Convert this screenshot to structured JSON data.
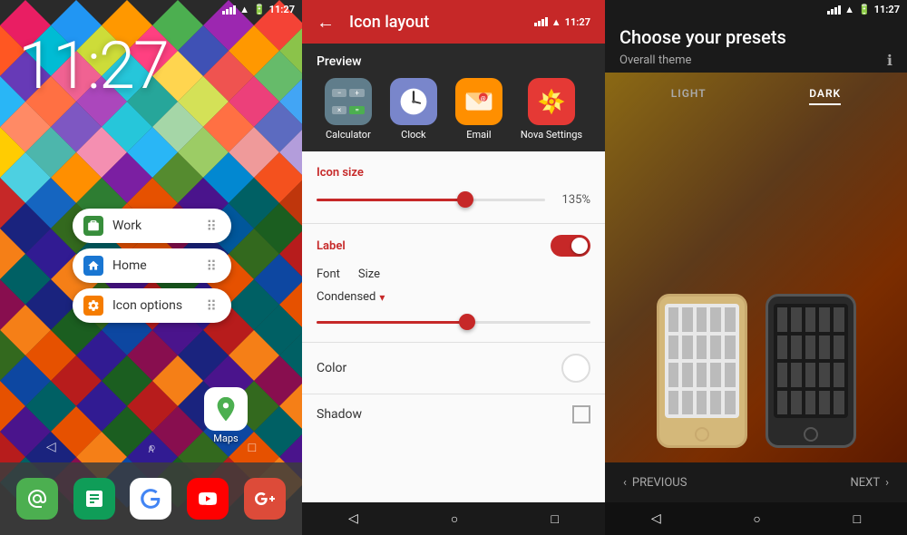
{
  "panel1": {
    "time": "11:27",
    "status_time": "11:27",
    "folders": [
      {
        "label": "Work",
        "icon": "briefcase",
        "color": "#388e3c"
      },
      {
        "label": "Home",
        "icon": "home",
        "color": "#1976d2"
      },
      {
        "label": "Icon options",
        "icon": "settings",
        "color": "#f57c00"
      }
    ],
    "maps_label": "Maps",
    "dock_apps": [
      "chat",
      "sheets",
      "google",
      "youtube",
      "google-plus"
    ],
    "nav": [
      "back",
      "home",
      "recent"
    ]
  },
  "panel2": {
    "title": "Icon layout",
    "status_time": "11:27",
    "preview_label": "Preview",
    "preview_apps": [
      {
        "label": "Calculator"
      },
      {
        "label": "Clock"
      },
      {
        "label": "Email"
      },
      {
        "label": "Nova Settings"
      }
    ],
    "icon_size_label": "Icon size",
    "icon_size_value": "135%",
    "icon_size_percent": 65,
    "label_label": "Label",
    "font_label": "Font",
    "size_label": "Size",
    "condensed_label": "Condensed",
    "font_slider_percent": 55,
    "color_label": "Color",
    "shadow_label": "Shadow"
  },
  "panel3": {
    "title": "Choose your presets",
    "subtitle": "Overall theme",
    "status_time": "11:27",
    "tabs": [
      {
        "label": "LIGHT",
        "active": false
      },
      {
        "label": "DARK",
        "active": true
      }
    ],
    "prev_label": "PREVIOUS",
    "next_label": "NEXT"
  }
}
